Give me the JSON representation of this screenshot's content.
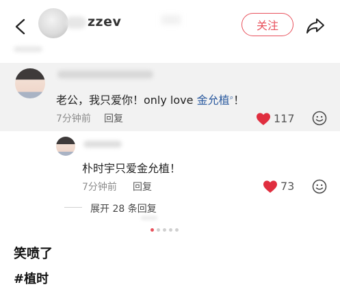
{
  "header": {
    "username": "zzev",
    "follow_label": "关注"
  },
  "comment": {
    "text_plain": "老公，我只爱你！only love ",
    "tag": "金允植",
    "tag_suffix": "！",
    "time": "7分钟前",
    "reply_label": "回复",
    "likes": "117"
  },
  "sub_reply": {
    "text": "朴时宇只爱金允植！",
    "time": "7分钟前",
    "reply_label": "回复",
    "likes": "73",
    "expand_label": "展开 28 条回复"
  },
  "post": {
    "caption": "笑喷了",
    "hashtag": "#植时"
  },
  "pagination": {
    "count": 5,
    "active": 0
  },
  "colors": {
    "accent": "#e8505b",
    "tag_blue": "#2b5a9f",
    "highlight_bg": "#f2f2f2"
  },
  "icons": [
    "back-arrow-icon",
    "share-icon",
    "heart-icon",
    "emoji-icon",
    "search-glyph-icon"
  ]
}
